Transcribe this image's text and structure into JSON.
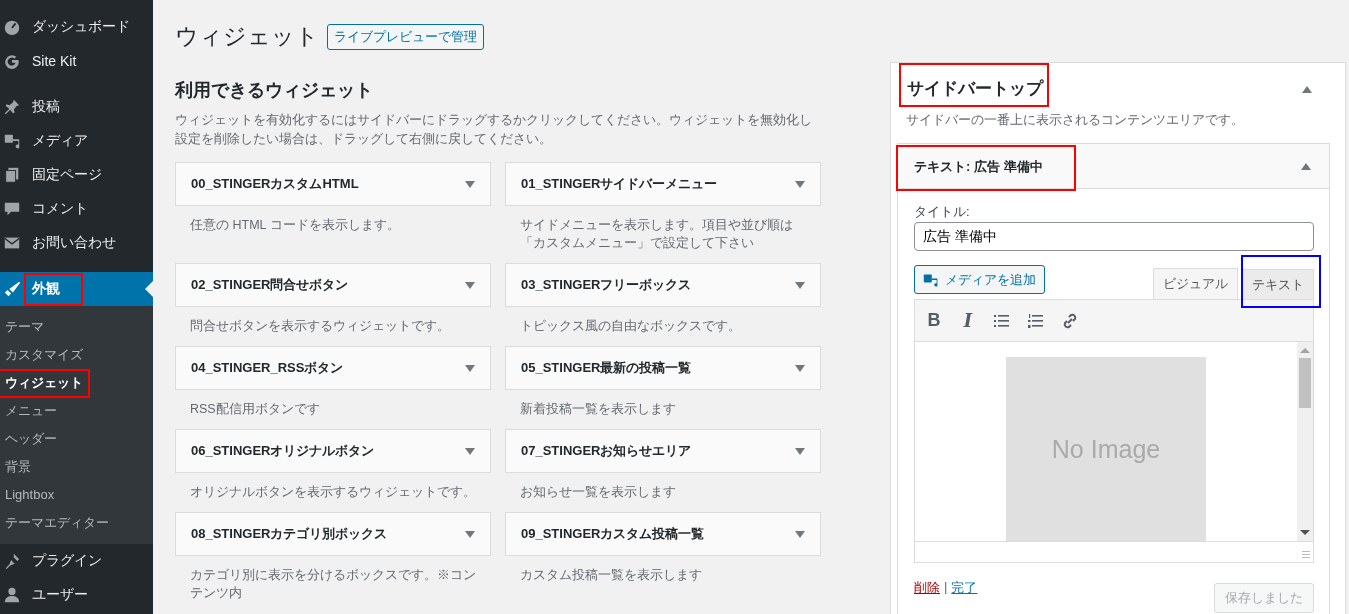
{
  "admin_menu": [
    {
      "items": [
        {
          "label": "ダッシュボード",
          "selected": false
        },
        {
          "label": "Site Kit",
          "selected": false
        }
      ]
    },
    {
      "items": [
        {
          "label": "投稿",
          "selected": false
        },
        {
          "label": "メディア",
          "selected": false
        },
        {
          "label": "固定ページ",
          "selected": false
        },
        {
          "label": "コメント",
          "selected": false
        },
        {
          "label": "お問い合わせ",
          "selected": false
        }
      ]
    },
    {
      "items": [
        {
          "label": "外観",
          "selected": true,
          "annotation_box": {
            "color": "#ff0000"
          },
          "children": [
            {
              "label": "テーマ",
              "selected": false
            },
            {
              "label": "カスタマイズ",
              "selected": false
            },
            {
              "label": "ウィジェット",
              "selected": true,
              "annotation_box": {
                "color": "#ff0000"
              }
            },
            {
              "label": "メニュー",
              "selected": false
            },
            {
              "label": "ヘッダー",
              "selected": false
            },
            {
              "label": "背景",
              "selected": false
            },
            {
              "label": "Lightbox",
              "selected": false
            },
            {
              "label": "テーマエディター",
              "selected": false
            }
          ]
        },
        {
          "label": "プラグイン",
          "selected": false
        },
        {
          "label": "ユーザー",
          "selected": false
        }
      ]
    }
  ],
  "page": {
    "title": "ウィジェット",
    "live_preview_button": "ライブプレビューで管理"
  },
  "available_widgets": {
    "heading": "利用できるウィジェット",
    "description": "ウィジェットを有効化するにはサイドバーにドラッグするかクリックしてください。ウィジェットを無効化し設定を削除したい場合は、ドラッグして右側に戻してください。",
    "widgets": [
      {
        "name": "00_STINGERカスタムHTML",
        "description": "任意の HTML コードを表示します。"
      },
      {
        "name": "01_STINGERサイドバーメニュー",
        "description": "サイドメニューを表示します。項目や並び順は「カスタムメニュー」で設定して下さい"
      },
      {
        "name": "02_STINGER問合せボタン",
        "description": "問合せボタンを表示するウィジェットです。"
      },
      {
        "name": "03_STINGERフリーボックス",
        "description": "トピックス風の自由なボックスです。"
      },
      {
        "name": "04_STINGER_RSSボタン",
        "description": "RSS配信用ボタンです"
      },
      {
        "name": "05_STINGER最新の投稿一覧",
        "description": "新着投稿一覧を表示します"
      },
      {
        "name": "06_STINGERオリジナルボタン",
        "description": "オリジナルボタンを表示するウィジェットです。"
      },
      {
        "name": "07_STINGERお知らせエリア",
        "description": "お知らせ一覧を表示します"
      },
      {
        "name": "08_STINGERカテゴリ別ボックス",
        "description": "カテゴリ別に表示を分けるボックスです。※コンテンツ内"
      },
      {
        "name": "09_STINGERカスタム投稿一覧",
        "description": "カスタム投稿一覧を表示します"
      }
    ]
  },
  "sidebar_area": {
    "title": "サイドバートップ",
    "annotation_box": {
      "color": "#ff0000"
    },
    "description": "サイドバーの一番上に表示されるコンテンツエリアです。",
    "expanded": true,
    "widget": {
      "header": "テキスト: 広告 準備中",
      "annotation_box": {
        "color": "#ff0000"
      },
      "expanded": true,
      "title_label": "タイトル:",
      "title_value": "広告 準備中",
      "add_media_button": "メディアを追加",
      "tabs": [
        {
          "label": "ビジュアル",
          "selected": true
        },
        {
          "label": "テキスト",
          "selected": false,
          "annotation_box": {
            "color": "#0000ff"
          }
        }
      ],
      "toolbar": [
        {
          "kind": "bold",
          "label": "B"
        },
        {
          "kind": "italic",
          "label": "I"
        },
        {
          "kind": "bullet-list"
        },
        {
          "kind": "numbered-list"
        },
        {
          "kind": "link"
        }
      ],
      "content_image_text": "No Image",
      "delete_link": "削除",
      "separator": "|",
      "done_link": "完了",
      "save_button": {
        "label": "保存しました",
        "disabled": true
      }
    }
  }
}
